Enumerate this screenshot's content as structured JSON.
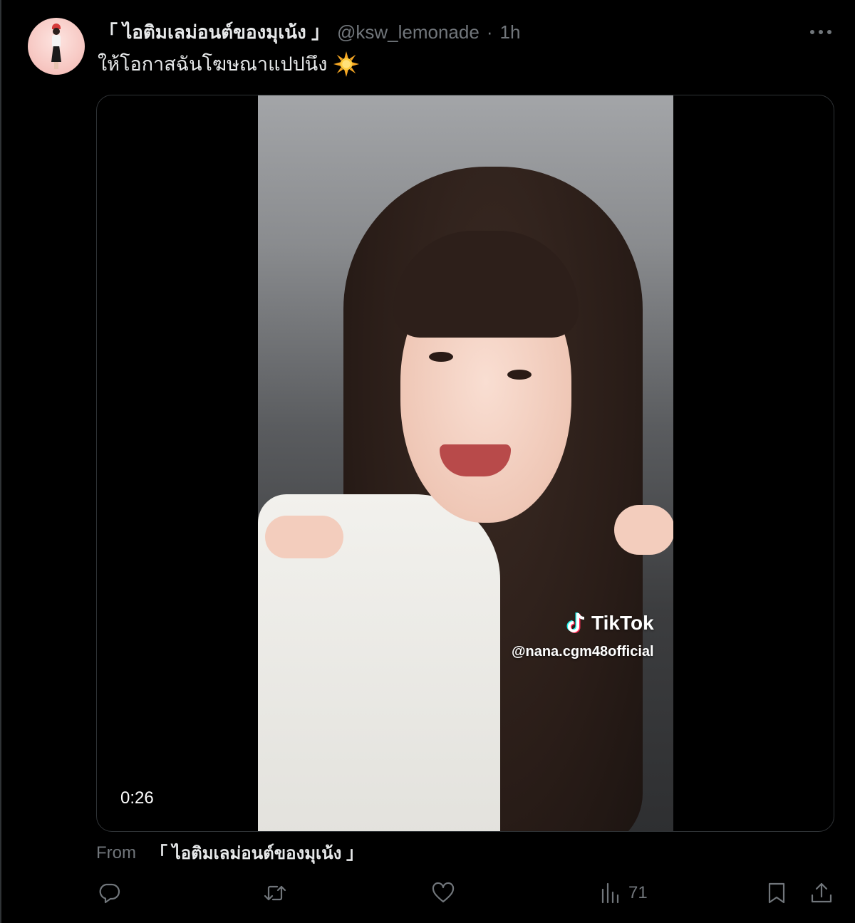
{
  "tweet": {
    "author": {
      "display_name": "「 ไอติมเลม่อนต์ของมุเน้ง 」",
      "handle": "@ksw_lemonade",
      "separator": "·",
      "time": "1h"
    },
    "text": "ให้โอกาสฉันโฆษณาแปปนึง",
    "emoji": "sun-emoji",
    "media": {
      "duration": "0:26",
      "watermark_brand": "TikTok",
      "watermark_user": "@nana.cgm48official"
    },
    "from": {
      "label": "From",
      "name": "「 ไอติมเลม่อนต์ของมุเน้ง 」"
    },
    "actions": {
      "views": "71"
    }
  },
  "colors": {
    "background": "#000000",
    "primary_text": "#e7e9ea",
    "secondary_text": "#71767b",
    "border": "#2f3336"
  }
}
